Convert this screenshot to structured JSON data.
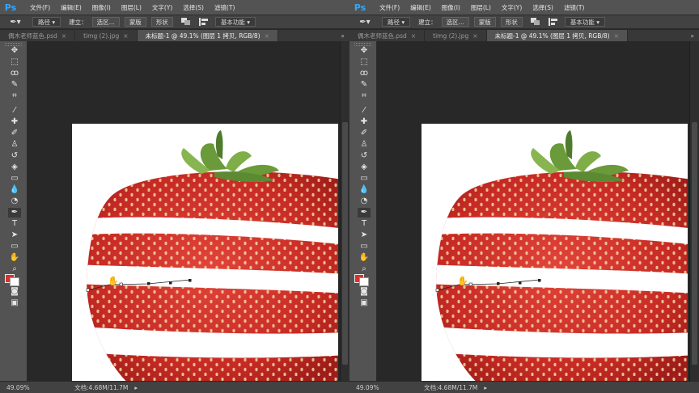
{
  "menubar": {
    "logo": "Ps",
    "items": [
      "文件(F)",
      "编辑(E)",
      "图像(I)",
      "图层(L)",
      "文字(Y)",
      "选择(S)",
      "滤镜(T)"
    ]
  },
  "options": {
    "mode": "路径",
    "make_label": "建立：",
    "selection_btn": "选区...",
    "mask_btn": "蒙版",
    "shape_btn": "形状",
    "workspace": "基本功能"
  },
  "tabs": [
    {
      "label": "偶木老师蓝色.psd",
      "close": "×"
    },
    {
      "label": "timg (2).jpg",
      "close": "×"
    },
    {
      "label": "未标题-1 @ 49.1% (图层 1 拷贝, RGB/8)",
      "close": "×"
    }
  ],
  "tabs_overflow": "»",
  "tools": [
    {
      "icon": "move-icon",
      "glyph": "✥"
    },
    {
      "icon": "marquee-icon",
      "glyph": "⬚"
    },
    {
      "icon": "lasso-icon",
      "glyph": "ꝏ"
    },
    {
      "icon": "quick-select-icon",
      "glyph": "✎"
    },
    {
      "icon": "crop-icon",
      "glyph": "⌗"
    },
    {
      "icon": "eyedropper-icon",
      "glyph": "⁄"
    },
    {
      "icon": "healing-brush-icon",
      "glyph": "✚"
    },
    {
      "icon": "brush-icon",
      "glyph": "✐"
    },
    {
      "icon": "clone-stamp-icon",
      "glyph": "♙"
    },
    {
      "icon": "history-brush-icon",
      "glyph": "↺"
    },
    {
      "icon": "eraser-icon",
      "glyph": "◈"
    },
    {
      "icon": "gradient-icon",
      "glyph": "▭"
    },
    {
      "icon": "blur-icon",
      "glyph": "💧"
    },
    {
      "icon": "dodge-icon",
      "glyph": "◔"
    },
    {
      "icon": "pen-icon",
      "glyph": "✒"
    },
    {
      "icon": "type-icon",
      "glyph": "T"
    },
    {
      "icon": "path-select-icon",
      "glyph": "➤"
    },
    {
      "icon": "rectangle-icon",
      "glyph": "▭"
    },
    {
      "icon": "hand-icon",
      "glyph": "✋"
    },
    {
      "icon": "zoom-icon",
      "glyph": "⌕"
    },
    {
      "icon": "more-tools-icon",
      "glyph": "···"
    }
  ],
  "colors": {
    "foreground": "#d5332f",
    "background": "#ffffff",
    "strawberry_red": "#d5332f",
    "leaf_green": "#6a9a3a"
  },
  "status": {
    "zoom": "49.09%",
    "doc": "文档:4.68M/11.7M",
    "arrow": "▸"
  }
}
